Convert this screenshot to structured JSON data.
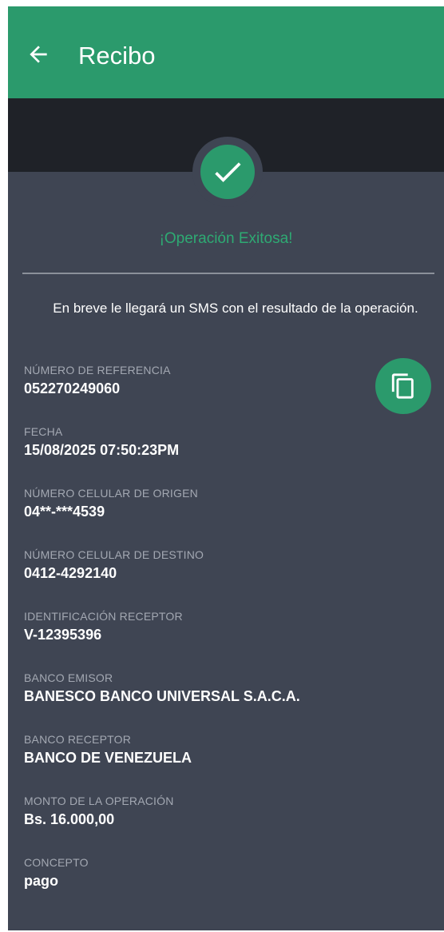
{
  "header": {
    "title": "Recibo",
    "back_icon": "arrow-left-icon"
  },
  "status": {
    "icon": "check-icon",
    "title": "¡Operación Exitosa!",
    "message": "En breve le llegará un SMS con el resultado de la operación."
  },
  "copy_icon": "copy-icon",
  "colors": {
    "accent": "#2b9a6c",
    "success_text": "#2eaa73",
    "background": "#3f4553",
    "dark_band": "#1f2228"
  },
  "fields": [
    {
      "label": "NÚMERO DE REFERENCIA",
      "value": "052270249060"
    },
    {
      "label": "FECHA",
      "value": "15/08/2025 07:50:23PM"
    },
    {
      "label": "NÚMERO CELULAR DE ORIGEN",
      "value": "04**-***4539"
    },
    {
      "label": "NÚMERO CELULAR DE DESTINO",
      "value": "0412-4292140"
    },
    {
      "label": "IDENTIFICACIÓN RECEPTOR",
      "value": "V-12395396"
    },
    {
      "label": "BANCO EMISOR",
      "value": "BANESCO BANCO UNIVERSAL S.A.C.A."
    },
    {
      "label": "BANCO RECEPTOR",
      "value": "BANCO DE VENEZUELA"
    },
    {
      "label": "MONTO DE LA OPERACIÓN",
      "value": "Bs. 16.000,00"
    },
    {
      "label": "CONCEPTO",
      "value": "pago"
    }
  ]
}
